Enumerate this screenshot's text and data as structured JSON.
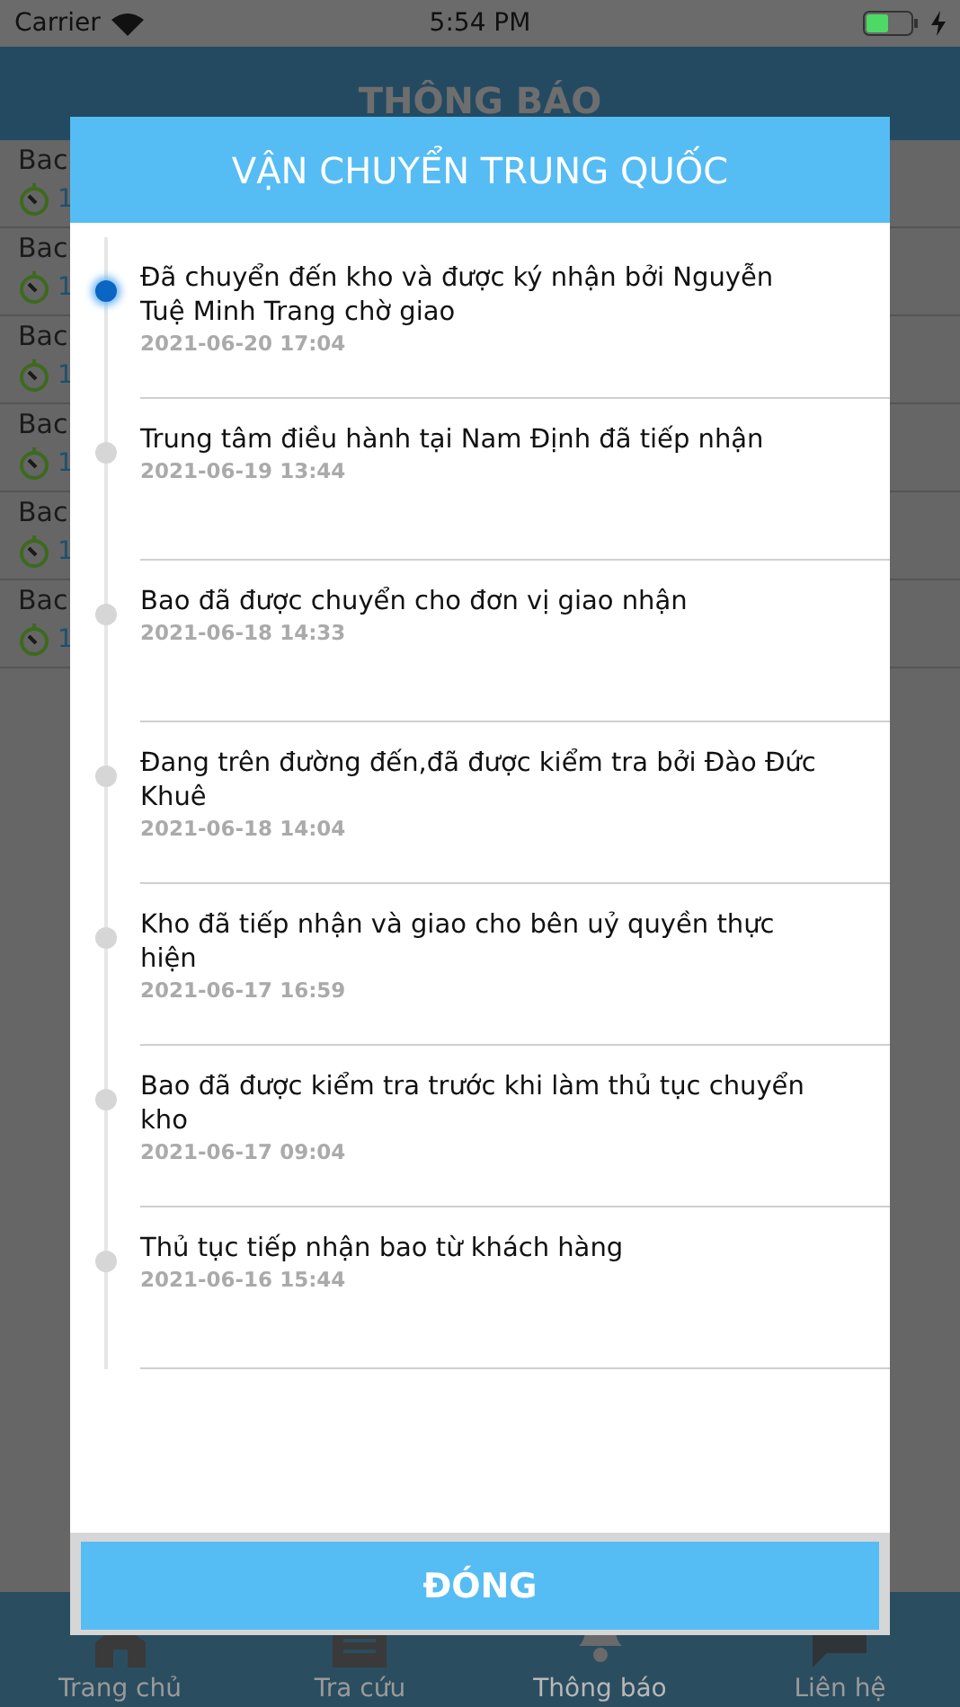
{
  "status_bar": {
    "carrier": "Carrier",
    "time": "5:54 PM",
    "battery": {
      "level": 0.5
    }
  },
  "header": {
    "title": "THÔNG BÁO"
  },
  "list_rows": [
    {
      "title": "Bac",
      "time": "1"
    },
    {
      "title": "Bac",
      "time": "1"
    },
    {
      "title": "Bac",
      "time": "1"
    },
    {
      "title": "Bac",
      "time": "1"
    },
    {
      "title": "Bac",
      "time": "1"
    },
    {
      "title": "Bac",
      "time": "1"
    }
  ],
  "dialog": {
    "title": "VẬN CHUYỂN TRUNG QUỐC",
    "events": [
      {
        "text": "Đã chuyển đến kho và được ký nhận bởi Nguyễn Tuệ Minh Trang chờ giao",
        "time": "2021-06-20 17:04",
        "current": true
      },
      {
        "text": "Trung tâm điều hành tại Nam Định đã tiếp nhận",
        "time": "2021-06-19 13:44",
        "current": false
      },
      {
        "text": "Bao đã được chuyển cho đơn vị giao nhận",
        "time": "2021-06-18 14:33",
        "current": false
      },
      {
        "text": "Đang trên đường đến,đã được kiểm tra bởi Đào Đức Khuê",
        "time": "2021-06-18 14:04",
        "current": false
      },
      {
        "text": "Kho đã tiếp nhận và giao cho bên uỷ quyền thực hiện",
        "time": "2021-06-17 16:59",
        "current": false
      },
      {
        "text": "Bao đã được kiểm tra trước khi làm thủ tục chuyển kho",
        "time": "2021-06-17 09:04",
        "current": false
      },
      {
        "text": "Thủ tục tiếp nhận bao từ khách hàng",
        "time": "2021-06-16 15:44",
        "current": false
      }
    ],
    "close_button": "ĐÓNG"
  },
  "tab_bar": [
    {
      "label": "Trang chủ",
      "kind": "home",
      "selected": false
    },
    {
      "label": "Tra cứu",
      "kind": "list",
      "selected": false
    },
    {
      "label": "Thông báo",
      "kind": "bell",
      "selected": true
    },
    {
      "label": "Liên hệ",
      "kind": "chat",
      "selected": false
    }
  ]
}
